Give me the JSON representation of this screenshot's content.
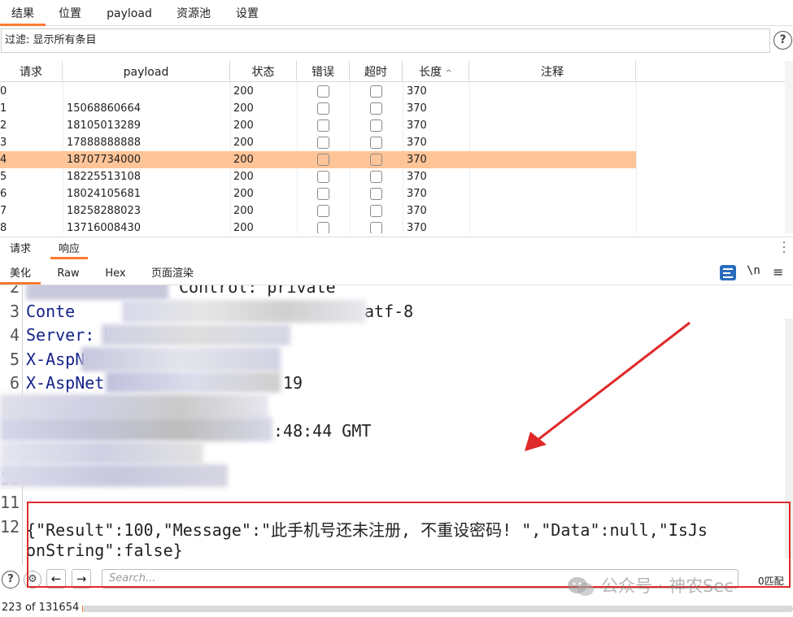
{
  "top_tabs": [
    "结果",
    "位置",
    "payload",
    "资源池",
    "设置"
  ],
  "filter": {
    "text": "过滤: 显示所有条目"
  },
  "help_label": "?",
  "table": {
    "columns": [
      "请求",
      "payload",
      "状态",
      "错误",
      "超时",
      "长度",
      "注释"
    ],
    "sort_indicator": "^",
    "rows": [
      {
        "request": "0",
        "payload": "",
        "status": "200",
        "length": "370"
      },
      {
        "request": "1",
        "payload": "15068860664",
        "status": "200",
        "length": "370"
      },
      {
        "request": "2",
        "payload": "18105013289",
        "status": "200",
        "length": "370"
      },
      {
        "request": "3",
        "payload": "17888888888",
        "status": "200",
        "length": "370"
      },
      {
        "request": "4",
        "payload": "18707734000",
        "status": "200",
        "length": "370"
      },
      {
        "request": "5",
        "payload": "18225513108",
        "status": "200",
        "length": "370"
      },
      {
        "request": "6",
        "payload": "18024105681",
        "status": "200",
        "length": "370"
      },
      {
        "request": "7",
        "payload": "18258288023",
        "status": "200",
        "length": "370"
      },
      {
        "request": "8",
        "payload": "13716008430",
        "status": "200",
        "length": "370"
      }
    ],
    "selected_row": 4
  },
  "message_tabs": [
    "请求",
    "响应"
  ],
  "view_tabs": [
    "美化",
    "Raw",
    "Hex",
    "页面渲染"
  ],
  "toolbar": {
    "newline_label": "\\n",
    "menu_label": "≡"
  },
  "editor": {
    "lines": [
      {
        "num": "2",
        "key": "",
        "rest": "Control: private"
      },
      {
        "num": "3",
        "key": "Conte",
        "rest": "atf-8"
      },
      {
        "num": "4",
        "key": "Server: M",
        "rest": ""
      },
      {
        "num": "5",
        "key": "X-AspN",
        "rest": ""
      },
      {
        "num": "6",
        "key": "X-AspNet",
        "rest": "19"
      },
      {
        "num": "7",
        "key": "X",
        "rest": ""
      },
      {
        "num": "8",
        "key": "",
        "rest": ":48:44 GMT"
      },
      {
        "num": "9",
        "key": "",
        "rest": ""
      },
      {
        "num": "10",
        "key": "",
        "rest": ""
      },
      {
        "num": "11",
        "key": "",
        "rest": ""
      },
      {
        "num": "12",
        "key": "",
        "rest": "{\"Result\":100,\"Message\":\"此手机号还未注册, 不重设密码! \",\"Data\":null,\"IsJs"
      }
    ],
    "continuation": "onString\":false}"
  },
  "search": {
    "placeholder": "Search..."
  },
  "match_count": "0匹配",
  "watermark": "公众号 · 神农Sec",
  "status": {
    "text": "223 of 131654",
    "progress": 0.0017
  },
  "colors": {
    "accent": "#ff7a30",
    "selected_row": "#ffc497",
    "highlight": "#e02a2a",
    "key_text": "#15228a"
  }
}
